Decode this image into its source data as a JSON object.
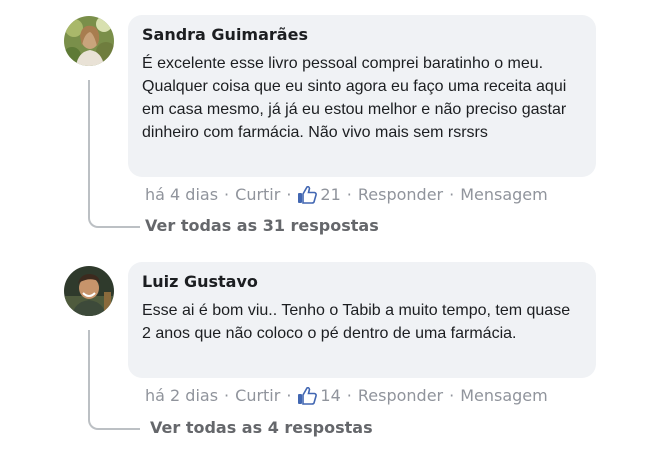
{
  "comments": [
    {
      "author": "Sandra Guimarães",
      "text": "É excelente esse livro pessoal comprei baratinho o meu. Qualquer coisa que eu sinto agora eu faço uma receita aqui em casa mesmo, já já eu estou melhor e não preciso gastar dinheiro com farmácia. Não vivo mais sem rsrsrs",
      "time": "há 4 dias",
      "like_label": "Curtir",
      "like_count": "21",
      "reply_label": "Responder",
      "message_label": "Mensagem",
      "view_replies": "Ver todas as 31 respostas",
      "avatar_icon": "user-photo-icon"
    },
    {
      "author": "Luiz Gustavo",
      "text": "Esse ai é bom viu.. Tenho o Tabib a muito tempo, tem quase 2 anos que não coloco o pé dentro de uma farmácia.",
      "time": "há 2 dias",
      "like_label": "Curtir",
      "like_count": "14",
      "reply_label": "Responder",
      "message_label": "Mensagem",
      "view_replies": "Ver todas as 4 respostas",
      "avatar_icon": "user-photo-icon"
    }
  ],
  "separator": "·",
  "colors": {
    "bubble": "#f0f2f5",
    "meta_text": "#90949c",
    "like_blue": "#4267b2",
    "thread_line": "#bcc0c4"
  }
}
